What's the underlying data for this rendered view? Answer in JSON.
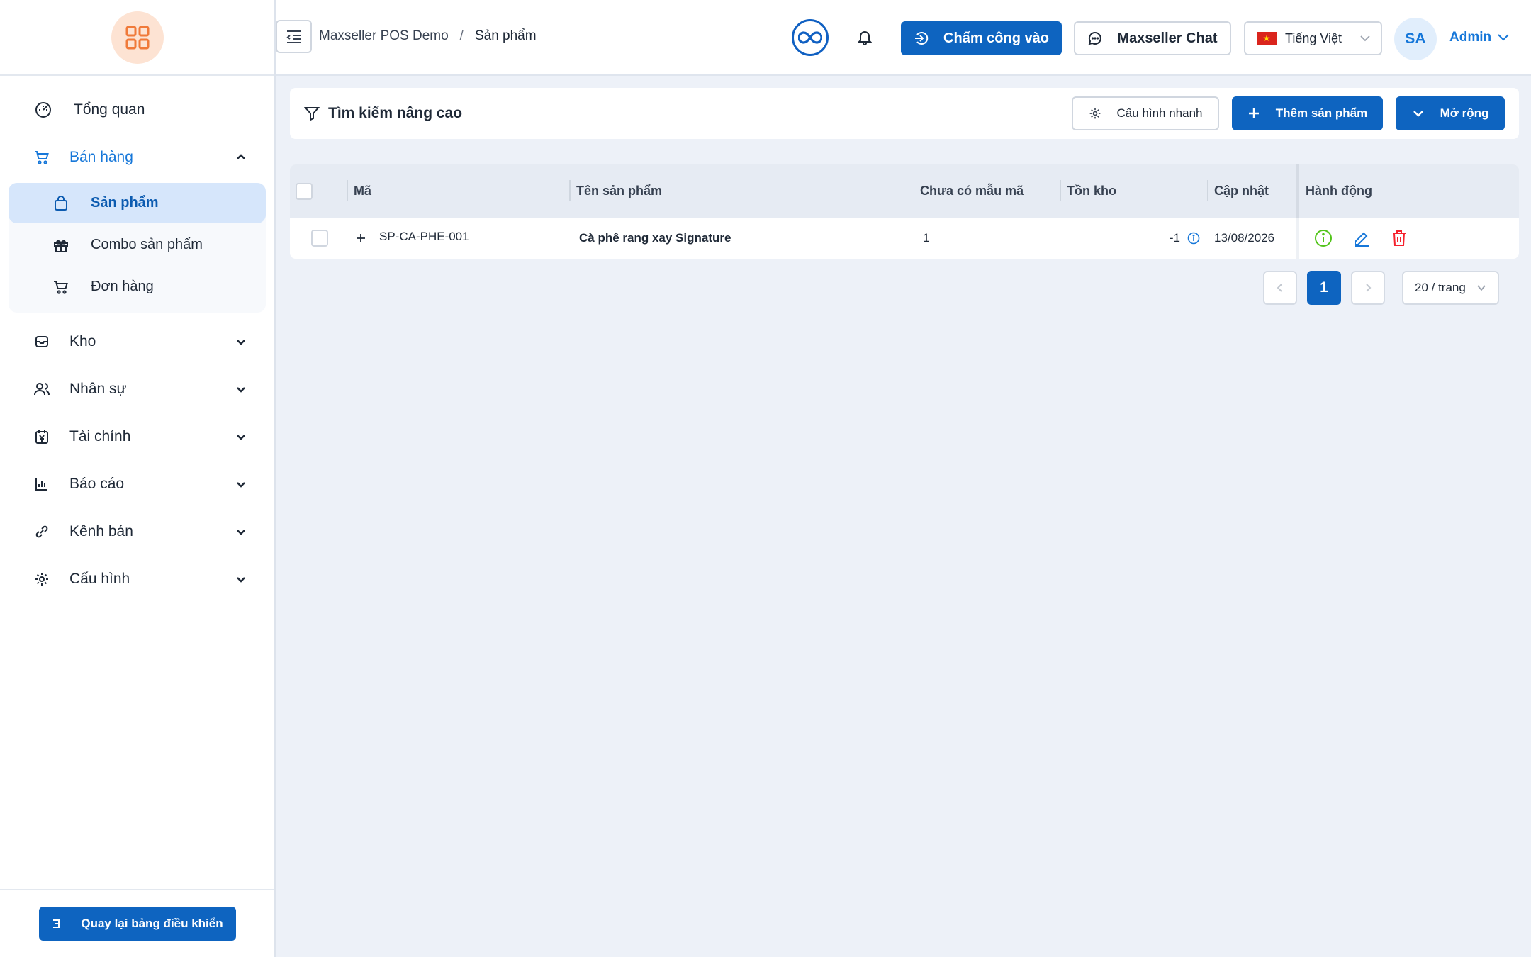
{
  "sidebar": {
    "items": [
      {
        "label": "Tổng quan",
        "icon": "dashboard-icon"
      },
      {
        "label": "Bán hàng",
        "icon": "cart-icon",
        "expanded": true
      },
      {
        "label": "Kho",
        "icon": "inbox-icon"
      },
      {
        "label": "Nhân sự",
        "icon": "users-icon"
      },
      {
        "label": "Tài chính",
        "icon": "finance-icon"
      },
      {
        "label": "Báo cáo",
        "icon": "chart-icon"
      },
      {
        "label": "Kênh bán",
        "icon": "channel-icon"
      },
      {
        "label": "Cấu hình",
        "icon": "gear-icon"
      }
    ],
    "submenu": [
      {
        "label": "Sản phẩm",
        "icon": "shopping-bag-icon",
        "active": true
      },
      {
        "label": "Combo sản phẩm",
        "icon": "gift-icon"
      },
      {
        "label": "Đơn hàng",
        "icon": "cart-icon"
      }
    ],
    "back_label": "Quay lại bảng điều khiển"
  },
  "header": {
    "breadcrumb": [
      "Maxseller POS Demo",
      "Sản phẩm"
    ],
    "breadcrumb_sep": "/",
    "checkin_label": "Chấm công vào",
    "chat_label": "Maxseller Chat",
    "language": "Tiếng Việt",
    "avatar_initials": "SA",
    "user_name": "Admin"
  },
  "toolbar": {
    "title": "Tìm kiếm nâng cao",
    "config_label": "Cấu hình nhanh",
    "add_label": "Thêm sản phẩm",
    "expand_label": "Mở rộng"
  },
  "table": {
    "columns": [
      "Mã",
      "Tên sản phẩm",
      "Chưa có mẫu mã",
      "Tồn kho",
      "Cập nhật",
      "Hành động"
    ],
    "rows": [
      {
        "code": "SP-CA-PHE-001",
        "name": "Cà phê rang xay Signature",
        "variants": "1",
        "stock": "-1",
        "updated": "13/08/2026"
      }
    ]
  },
  "pagination": {
    "current": "1",
    "page_size": "20 / trang"
  },
  "colors": {
    "primary": "#0e64c0",
    "accent": "#1677d9",
    "logo_bg": "#fde3d3",
    "logo_fg": "#f07a3a",
    "success": "#52c41a",
    "danger": "#f5222d"
  }
}
